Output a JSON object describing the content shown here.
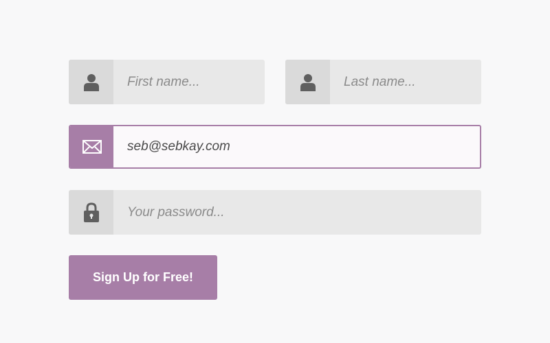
{
  "form": {
    "first_name": {
      "placeholder": "First name...",
      "value": "",
      "icon": "user-icon"
    },
    "last_name": {
      "placeholder": "Last name...",
      "value": "",
      "icon": "user-icon"
    },
    "email": {
      "placeholder": "",
      "value": "seb@sebkay.com",
      "icon": "envelope-icon",
      "state": "focused"
    },
    "password": {
      "placeholder": "Your password...",
      "value": "",
      "icon": "lock-icon"
    },
    "submit_label": "Sign Up for Free!"
  },
  "colors": {
    "accent": "#a77ea7",
    "background": "#f8f8f9",
    "field_bg": "#e8e8e8",
    "icon_box_bg": "#dadada",
    "icon_color": "#5f5f5f"
  }
}
